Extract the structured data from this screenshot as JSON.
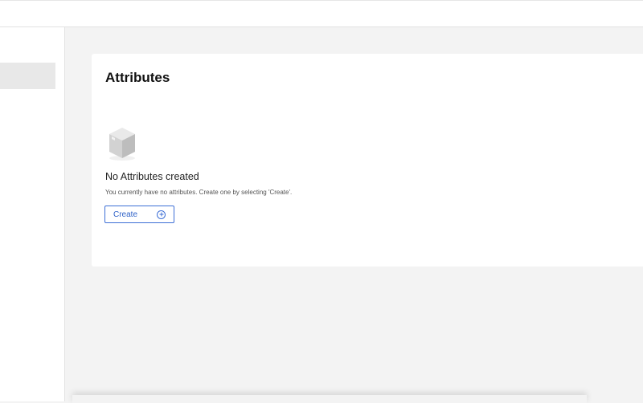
{
  "page": {
    "title": "Attributes"
  },
  "empty_state": {
    "title": "No Attributes created",
    "description": "You currently have no attributes. Create one by selecting 'Create'.",
    "create_label": "Create"
  }
}
